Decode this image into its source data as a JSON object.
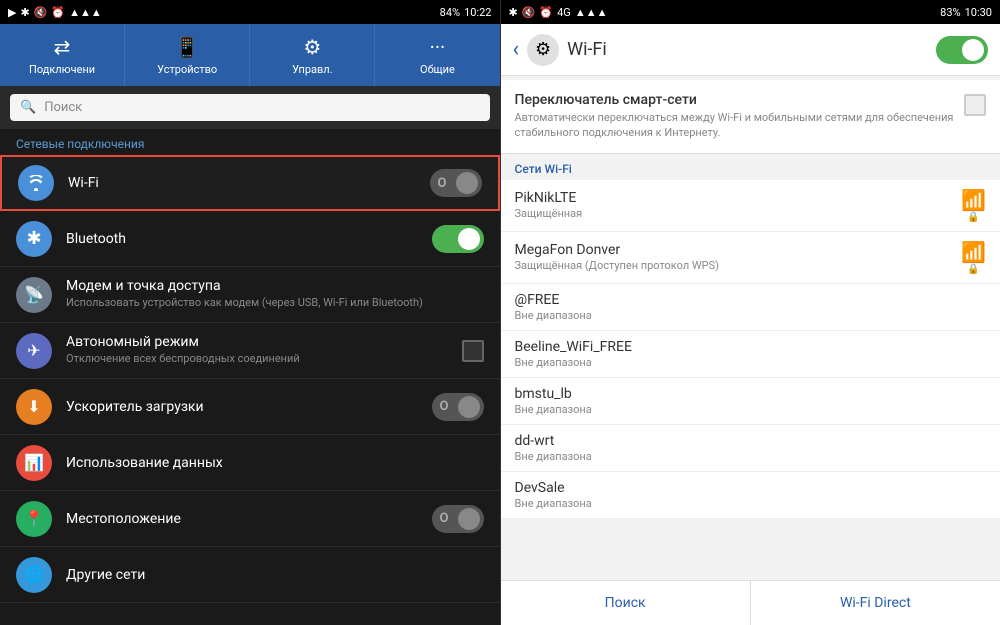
{
  "left": {
    "statusBar": {
      "time": "10:22",
      "batteryPercent": "84%"
    },
    "tabs": [
      {
        "label": "Подключени",
        "icon": "⇄",
        "active": false
      },
      {
        "label": "Устройство",
        "icon": "📱",
        "active": false
      },
      {
        "label": "Управл.",
        "icon": "⚙",
        "active": false
      },
      {
        "label": "Общие",
        "icon": "···",
        "active": false
      }
    ],
    "search": {
      "placeholder": "Поиск"
    },
    "sectionLabel": "Сетевые подключения",
    "menuItems": [
      {
        "id": "wifi",
        "title": "Wi-Fi",
        "subtitle": "",
        "hasToggle": "off",
        "highlighted": true
      },
      {
        "id": "bluetooth",
        "title": "Bluetooth",
        "subtitle": "",
        "hasToggle": "on",
        "highlighted": false
      },
      {
        "id": "modem",
        "title": "Модем и точка доступа",
        "subtitle": "Использовать устройство как модем (через USB, Wi-Fi или Bluetooth)",
        "hasToggle": "",
        "highlighted": false
      },
      {
        "id": "airplane",
        "title": "Автономный режим",
        "subtitle": "Отключение всех беспроводных соединений",
        "hasToggle": "checkbox",
        "highlighted": false
      },
      {
        "id": "download",
        "title": "Ускоритель загрузки",
        "subtitle": "",
        "hasToggle": "off2",
        "highlighted": false
      },
      {
        "id": "data",
        "title": "Использование данных",
        "subtitle": "",
        "hasToggle": "",
        "highlighted": false
      },
      {
        "id": "location",
        "title": "Местоположение",
        "subtitle": "",
        "hasToggle": "off3",
        "highlighted": false
      },
      {
        "id": "other",
        "title": "Другие сети",
        "subtitle": "",
        "hasToggle": "",
        "highlighted": false
      }
    ]
  },
  "right": {
    "statusBar": {
      "time": "10:30",
      "batteryPercent": "83%"
    },
    "header": {
      "title": "Wi-Fi"
    },
    "smartSwitch": {
      "title": "Переключатель смарт-сети",
      "description": "Автоматически переключаться между Wi-Fi и мобильными сетями для обеспечения стабильного подключения к Интернету."
    },
    "networksLabel": "Сети Wi-Fi",
    "networks": [
      {
        "name": "PikNikLTE",
        "status": "Защищённая",
        "secured": true,
        "inRange": true
      },
      {
        "name": "MegaFon Donver",
        "status": "Защищённая (Доступен протокол WPS)",
        "secured": true,
        "inRange": true
      },
      {
        "name": "@FREE",
        "status": "Вне диапазона",
        "secured": false,
        "inRange": false
      },
      {
        "name": "Beeline_WiFi_FREE",
        "status": "Вне диапазона",
        "secured": false,
        "inRange": false
      },
      {
        "name": "bmstu_lb",
        "status": "Вне диапазона",
        "secured": false,
        "inRange": false
      },
      {
        "name": "dd-wrt",
        "status": "Вне диапазона",
        "secured": false,
        "inRange": false
      },
      {
        "name": "DevSale",
        "status": "Вне диапазона",
        "secured": false,
        "inRange": false
      }
    ],
    "buttons": {
      "search": "Поиск",
      "wifiDirect": "Wi-Fi Direct"
    }
  }
}
